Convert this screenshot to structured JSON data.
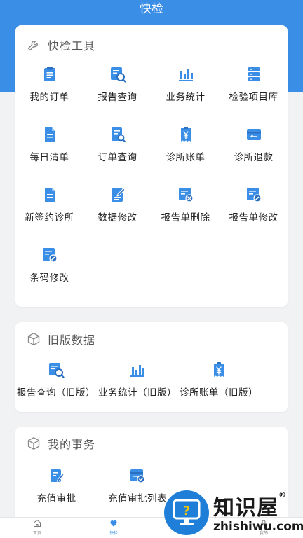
{
  "header": {
    "title": "快检"
  },
  "sections": [
    {
      "title": "快检工具",
      "icon": "wrench-icon",
      "items": [
        {
          "label": "我的订单",
          "icon": "clipboard-icon"
        },
        {
          "label": "报告查询",
          "icon": "report-search-icon"
        },
        {
          "label": "业务统计",
          "icon": "bar-chart-icon"
        },
        {
          "label": "检验项目库",
          "icon": "database-icon"
        },
        {
          "label": "每日清单",
          "icon": "document-icon"
        },
        {
          "label": "订单查询",
          "icon": "order-search-icon"
        },
        {
          "label": "诊所账单",
          "icon": "yuan-bill-icon"
        },
        {
          "label": "诊所退款",
          "icon": "refund-card-icon"
        },
        {
          "label": "新签约诊所",
          "icon": "document-icon"
        },
        {
          "label": "数据修改",
          "icon": "edit-document-icon"
        },
        {
          "label": "报告单删除",
          "icon": "report-delete-icon"
        },
        {
          "label": "报告单修改",
          "icon": "report-edit-icon"
        },
        {
          "label": "条码修改",
          "icon": "barcode-edit-icon"
        }
      ]
    },
    {
      "title": "旧版数据",
      "icon": "cube-icon",
      "items": [
        {
          "label": "报告查询（旧版）",
          "icon": "report-search-icon"
        },
        {
          "label": "业务统计（旧版）",
          "icon": "bar-chart-icon"
        },
        {
          "label": "诊所账单（旧版）",
          "icon": "yuan-bill-icon"
        }
      ]
    },
    {
      "title": "我的事务",
      "icon": "cube-icon",
      "items": [
        {
          "label": "充值审批",
          "icon": "approval-icon"
        },
        {
          "label": "充值审批列表",
          "icon": "approval-list-icon"
        }
      ]
    }
  ],
  "tabbar": [
    {
      "label": "首页",
      "icon": "home-icon",
      "active": false
    },
    {
      "label": "快检",
      "icon": "heart-icon",
      "active": true
    },
    {
      "label": "我的",
      "icon": "user-icon",
      "active": false
    }
  ],
  "watermark": {
    "brand": "知识屋",
    "registered": "®",
    "url": "zhishiwu.com"
  },
  "colors": {
    "primary": "#3a8ee6",
    "background": "#f1f2f4",
    "card": "#ffffff"
  }
}
